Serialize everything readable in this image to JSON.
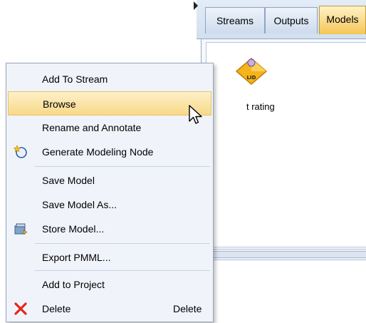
{
  "manager": {
    "tabs": [
      {
        "label": "Streams",
        "active": false
      },
      {
        "label": "Outputs",
        "active": false
      },
      {
        "label": "Models",
        "active": true
      }
    ],
    "model_label": "t rating",
    "model_icon_text": "LID"
  },
  "menu": {
    "items": [
      {
        "label": "Add To Stream",
        "icon": null
      },
      {
        "label": "Browse",
        "icon": null,
        "highlighted": true
      },
      {
        "label": "Rename and Annotate",
        "icon": null
      },
      {
        "label": "Generate Modeling Node",
        "icon": "generate-node-icon"
      },
      {
        "label": "Save Model",
        "icon": null
      },
      {
        "label": "Save Model As...",
        "icon": null
      },
      {
        "label": "Store Model...",
        "icon": "store-model-icon"
      },
      {
        "label": "Export PMML...",
        "icon": null
      },
      {
        "label": "Add to Project",
        "icon": null
      },
      {
        "label": "Delete",
        "icon": "delete-x-icon",
        "shortcut": "Delete"
      }
    ]
  },
  "colors": {
    "highlight": "#f8d98a",
    "active_tab": "#f5c556",
    "menu_bg": "#f0f4fa",
    "delete_icon": "#e3261b"
  }
}
